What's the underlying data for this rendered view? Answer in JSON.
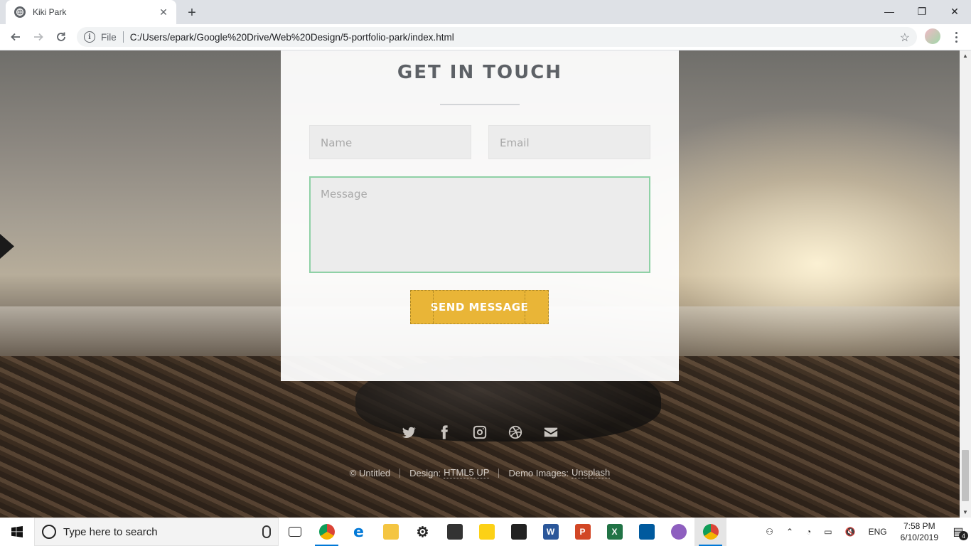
{
  "browser": {
    "tab_title": "Kiki Park",
    "tab_close": "✕",
    "new_tab": "+",
    "omnibox": {
      "scheme_label": "File",
      "url": "C:/Users/epark/Google%20Drive/Web%20Design/5-portfolio-park/index.html"
    },
    "window_controls": {
      "minimize": "—",
      "restore": "❐",
      "close": "✕"
    }
  },
  "page": {
    "contact": {
      "title": "GET IN TOUCH",
      "name_placeholder": "Name",
      "email_placeholder": "Email",
      "message_placeholder": "Message",
      "send_label": "SEND MESSAGE"
    },
    "socials": [
      "twitter-icon",
      "facebook-icon",
      "instagram-icon",
      "dribbble-icon",
      "envelope-icon"
    ],
    "footer": {
      "copyright": "© Untitled",
      "design_prefix": "Design:",
      "design_link": "HTML5 UP",
      "images_prefix": "Demo Images:",
      "images_link": "Unsplash"
    }
  },
  "taskbar": {
    "search_placeholder": "Type here to search",
    "language": "ENG",
    "time": "7:58 PM",
    "date": "6/10/2019",
    "notification_count": "4"
  },
  "colors": {
    "accent_button": "#e9b537",
    "focus_border": "#8fd1a6",
    "title_text": "#5d6166"
  }
}
